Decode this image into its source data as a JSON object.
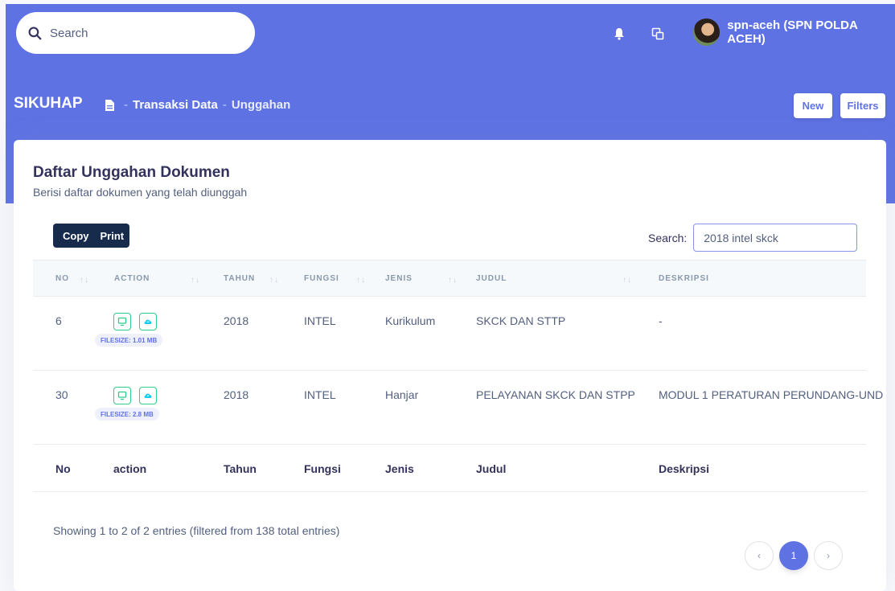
{
  "header": {
    "search_placeholder": "Search",
    "user_name": "spn-aceh (SPN POLDA ACEH)",
    "brand": "SIKUHAP",
    "breadcrumb": [
      {
        "label": "Transaksi Data"
      },
      {
        "label": "Unggahan"
      }
    ],
    "breadcrumb_separator": "-",
    "new_label": "New",
    "filters_label": "Filters"
  },
  "card": {
    "title": "Daftar Unggahan Dokumen",
    "subtitle": "Berisi daftar dokumen yang telah diunggah",
    "copy_label": "Copy",
    "print_label": "Print",
    "search_label": "Search:",
    "search_value": "2018 intel skck"
  },
  "table": {
    "headers": [
      "NO",
      "ACTION",
      "TAHUN",
      "FUNGSI",
      "JENIS",
      "JUDUL",
      "DESKRIPSI"
    ],
    "sort_glyph": "↑↓",
    "rows": [
      {
        "no": "6",
        "filesize": "FILESIZE: 1.01 MB",
        "tahun": "2018",
        "fungsi": "INTEL",
        "jenis": "Kurikulum",
        "judul": "SKCK DAN STTP",
        "deskripsi": "-"
      },
      {
        "no": "30",
        "filesize": "FILESIZE: 2.8 MB",
        "tahun": "2018",
        "fungsi": "INTEL",
        "jenis": "Hanjar",
        "judul": "PELAYANAN SKCK DAN STPP",
        "deskripsi": "MODUL 1 PERATURAN PERUNDANG-UND"
      }
    ],
    "footers": [
      "No",
      "action",
      "Tahun",
      "Fungsi",
      "Jenis",
      "Judul",
      "Deskripsi"
    ]
  },
  "info": "Showing 1 to 2 of 2 entries (filtered from 138 total entries)",
  "pagination": {
    "prev": "‹",
    "current": "1",
    "next": "›"
  },
  "colors": {
    "primary": "#5e72e4",
    "success": "#2dce89",
    "dark": "#172b4d"
  }
}
